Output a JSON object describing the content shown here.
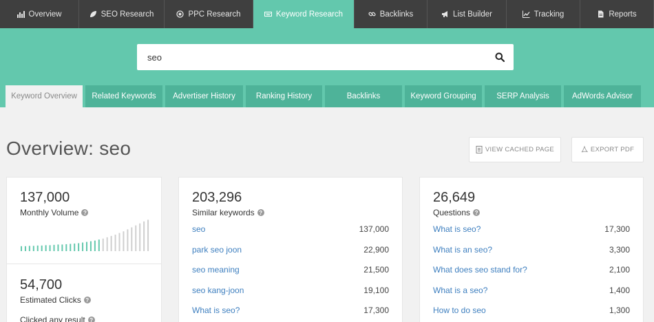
{
  "nav": {
    "tabs": [
      {
        "label": "Overview",
        "icon": "bar-chart-icon",
        "width": 115
      },
      {
        "label": "SEO Research",
        "icon": "leaf-icon",
        "width": 124
      },
      {
        "label": "PPC Research",
        "icon": "target-icon",
        "width": 129
      },
      {
        "label": "Keyword Research",
        "icon": "keyboard-icon",
        "width": 147,
        "active": true
      },
      {
        "label": "Backlinks",
        "icon": "link-icon",
        "width": 106
      },
      {
        "label": "List Builder",
        "icon": "megaphone-icon",
        "width": 115
      },
      {
        "label": "Tracking",
        "icon": "line-chart-icon",
        "width": 107
      },
      {
        "label": "Reports",
        "icon": "document-icon",
        "width": 107
      }
    ]
  },
  "search": {
    "value": "seo",
    "icon": "search-icon"
  },
  "subtabs": [
    {
      "label": "Keyword Overview",
      "width": 112,
      "active": true
    },
    {
      "label": "Related Keywords",
      "width": 112
    },
    {
      "label": "Advertiser History",
      "width": 113
    },
    {
      "label": "Ranking History",
      "width": 111
    },
    {
      "label": "Backlinks",
      "width": 112
    },
    {
      "label": "Keyword Grouping",
      "width": 112
    },
    {
      "label": "SERP Analysis",
      "width": 111
    },
    {
      "label": "AdWords Advisor",
      "width": 112
    }
  ],
  "page": {
    "title": "Overview: seo"
  },
  "actions": {
    "view_cached": "VIEW CACHED PAGE",
    "export_pdf": "EXPORT PDF"
  },
  "volume_card": {
    "monthly_volume": "137,000",
    "monthly_volume_label": "Monthly Volume",
    "trend": [
      0.15,
      0.15,
      0.16,
      0.16,
      0.17,
      0.17,
      0.18,
      0.18,
      0.19,
      0.2,
      0.2,
      0.21,
      0.22,
      0.23,
      0.24,
      0.26,
      0.28,
      0.3,
      0.32,
      0.35,
      0.38,
      0.42,
      0.46,
      0.5,
      0.55,
      0.6,
      0.66,
      0.72,
      0.78,
      0.84,
      0.9,
      0.95
    ],
    "trend_colors": {
      "recent": "#63c8ad",
      "past": "#cfcfcf"
    },
    "estimated_clicks": "54,700",
    "estimated_clicks_label": "Estimated Clicks",
    "clicked_any_label": "Clicked any result"
  },
  "similar_card": {
    "count": "203,296",
    "label": "Similar keywords",
    "rows": [
      {
        "kw": "seo",
        "vol": "137,000"
      },
      {
        "kw": "park seo joon",
        "vol": "22,900"
      },
      {
        "kw": "seo meaning",
        "vol": "21,500"
      },
      {
        "kw": "seo kang-joon",
        "vol": "19,100"
      },
      {
        "kw": "What is seo?",
        "vol": "17,300"
      }
    ]
  },
  "questions_card": {
    "count": "26,649",
    "label": "Questions",
    "rows": [
      {
        "kw": "What is seo?",
        "vol": "17,300"
      },
      {
        "kw": "What is an seo?",
        "vol": "3,300"
      },
      {
        "kw": "What does seo stand for?",
        "vol": "2,100"
      },
      {
        "kw": "What is a seo?",
        "vol": "1,400"
      },
      {
        "kw": "How to do seo",
        "vol": "1,300"
      }
    ]
  }
}
